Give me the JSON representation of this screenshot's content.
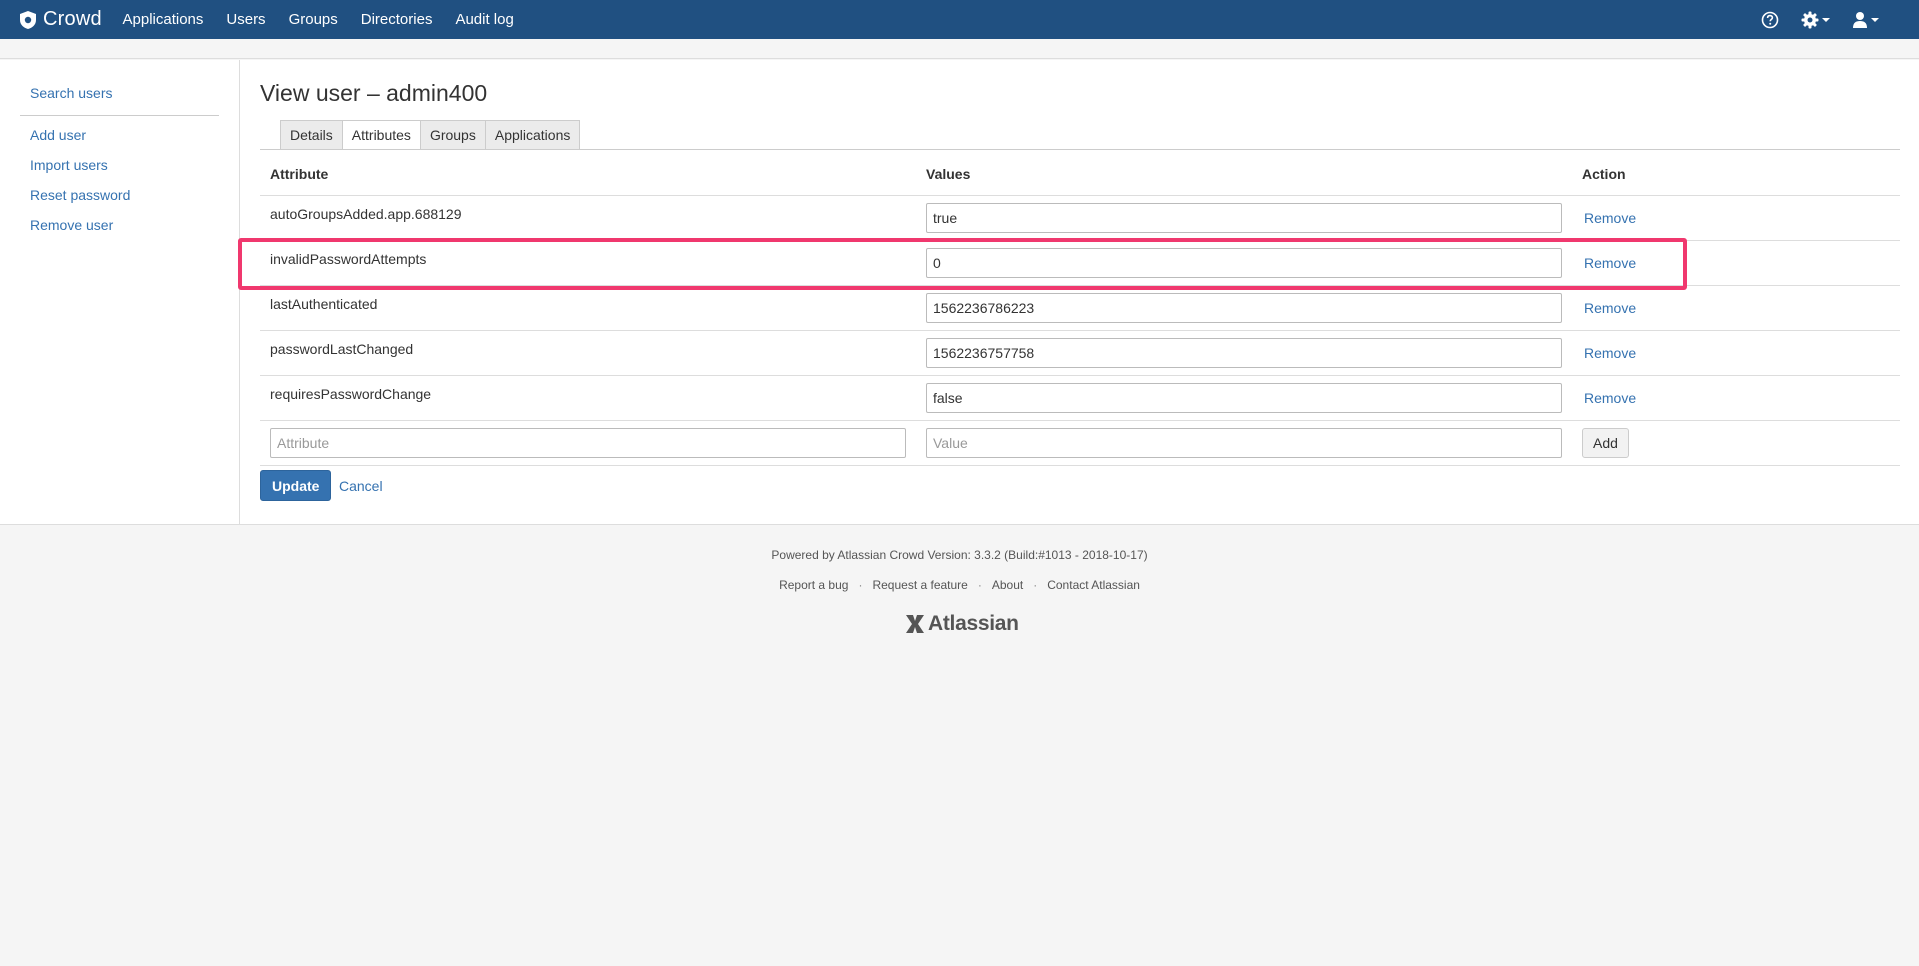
{
  "nav": {
    "brand": "Crowd",
    "items": [
      {
        "label": "Applications"
      },
      {
        "label": "Users"
      },
      {
        "label": "Groups"
      },
      {
        "label": "Directories"
      },
      {
        "label": "Audit log"
      }
    ],
    "right_icons": [
      "help-icon",
      "settings-icon",
      "user-icon"
    ]
  },
  "sidebar": {
    "search": "Search users",
    "items": [
      {
        "label": "Add user"
      },
      {
        "label": "Import users"
      },
      {
        "label": "Reset password"
      },
      {
        "label": "Remove user"
      }
    ]
  },
  "page": {
    "title": "View user – admin400",
    "tabs": [
      {
        "label": "Details"
      },
      {
        "label": "Attributes",
        "active": true
      },
      {
        "label": "Groups"
      },
      {
        "label": "Applications"
      }
    ]
  },
  "table": {
    "headers": {
      "attribute": "Attribute",
      "values": "Values",
      "action": "Action"
    },
    "rows": [
      {
        "attribute": "autoGroupsAdded.app.688129",
        "value": "true",
        "action": "Remove"
      },
      {
        "attribute": "invalidPasswordAttempts",
        "value": "0",
        "action": "Remove"
      },
      {
        "attribute": "lastAuthenticated",
        "value": "1562236786223",
        "action": "Remove"
      },
      {
        "attribute": "passwordLastChanged",
        "value": "1562236757758",
        "action": "Remove"
      },
      {
        "attribute": "requiresPasswordChange",
        "value": "false",
        "action": "Remove"
      }
    ],
    "new_row": {
      "attribute_placeholder": "Attribute",
      "value_placeholder": "Value",
      "add_label": "Add"
    }
  },
  "actions": {
    "update": "Update",
    "cancel": "Cancel"
  },
  "footer": {
    "powered": "Powered by Atlassian Crowd Version: 3.3.2 (Build:#1013 - 2018-10-17)",
    "links": [
      {
        "label": "Report a bug"
      },
      {
        "label": "Request a feature"
      },
      {
        "label": "About"
      },
      {
        "label": "Contact Atlassian"
      }
    ],
    "separator": "·",
    "logo": "Atlassian"
  },
  "colors": {
    "nav_bg": "#205081",
    "link": "#3572b0",
    "primary_button": "#3572b0",
    "highlight": "#f0386e"
  }
}
